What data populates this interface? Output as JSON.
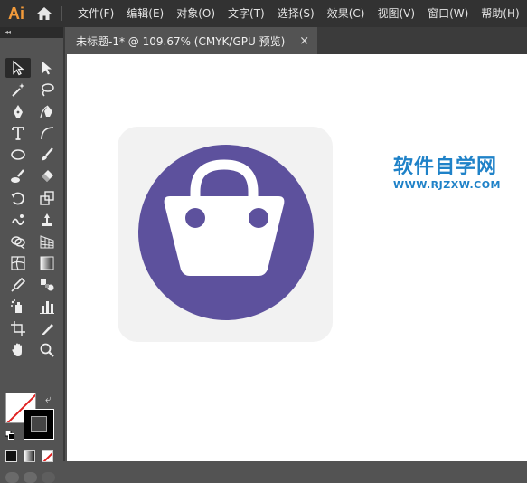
{
  "app": {
    "logo": "Ai"
  },
  "menu": [
    {
      "label": "文件(F)"
    },
    {
      "label": "编辑(E)"
    },
    {
      "label": "对象(O)"
    },
    {
      "label": "文字(T)"
    },
    {
      "label": "选择(S)"
    },
    {
      "label": "效果(C)"
    },
    {
      "label": "视图(V)"
    },
    {
      "label": "窗口(W)"
    },
    {
      "label": "帮助(H)"
    }
  ],
  "document": {
    "tab_title": "未标题-1* @ 109.67% (CMYK/GPU 预览)",
    "close_glyph": "×"
  },
  "toolbox": {
    "collapse_glyph": "◂◂",
    "tools": [
      "selection-tool",
      "direct-selection-tool",
      "magic-wand-tool",
      "lasso-tool",
      "pen-tool",
      "curvature-tool",
      "type-tool",
      "arc-tool",
      "ellipse-tool",
      "paintbrush-tool",
      "blob-brush-tool",
      "eraser-tool",
      "rotate-tool",
      "scale-tool",
      "warp-tool",
      "free-transform-tool",
      "shape-builder-tool",
      "perspective-grid-tool",
      "mesh-tool",
      "gradient-tool",
      "eyedropper-tool",
      "blend-tool",
      "symbol-sprayer-tool",
      "column-graph-tool",
      "artboard-tool",
      "slice-tool",
      "hand-tool",
      "zoom-tool"
    ],
    "active_tool": "selection-tool"
  },
  "artwork": {
    "background_color": "#f2f2f2",
    "circle_color": "#5d519d",
    "bag_color": "#ffffff"
  },
  "watermark": {
    "title": "软件自学网",
    "url": "WWW.RJZXW.COM",
    "color": "#1f82c8"
  },
  "colors": {
    "menubar": "#323232",
    "panel": "#535353",
    "canvas": "#ffffff",
    "logo": "#f29a3a"
  }
}
